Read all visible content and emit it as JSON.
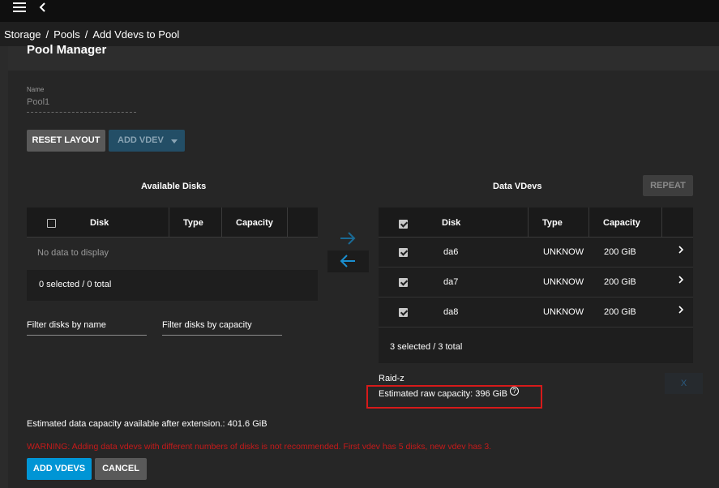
{
  "topbar": {
    "menu_icon": "hamburger-menu-icon",
    "back_icon": "chevron-left-icon"
  },
  "breadcrumb": {
    "items": [
      "Storage",
      "Pools",
      "Add Vdevs to Pool"
    ],
    "separator": "/"
  },
  "page": {
    "title": "Pool Manager",
    "name_label": "Name",
    "name_value": "Pool1",
    "reset_layout": "RESET LAYOUT",
    "add_vdev": "ADD VDEV"
  },
  "available_disks": {
    "title": "Available Disks",
    "columns": [
      "Disk",
      "Type",
      "Capacity"
    ],
    "empty_text": "No data to display",
    "footer": "0 selected / 0 total",
    "filter_name": "Filter disks by name",
    "filter_capacity": "Filter disks by capacity"
  },
  "data_vdevs": {
    "title": "Data VDevs",
    "repeat": "REPEAT",
    "columns": [
      "Disk",
      "Type",
      "Capacity"
    ],
    "rows": [
      {
        "disk": "da6",
        "type": "UNKNOW",
        "capacity": "200 GiB",
        "checked": true
      },
      {
        "disk": "da7",
        "type": "UNKNOW",
        "capacity": "200 GiB",
        "checked": true
      },
      {
        "disk": "da8",
        "type": "UNKNOW",
        "capacity": "200 GiB",
        "checked": true
      }
    ],
    "footer": "3 selected / 3 total",
    "raid_type": "Raid-z",
    "estimated_raw": "Estimated raw capacity: 396 GiB",
    "remove_label": "X"
  },
  "summary": {
    "estimated_data": "Estimated data capacity available after extension.: 401.6 GiB",
    "warning": "WARNING: Adding data vdevs with different numbers of disks is not recommended. First vdev has 5 disks, new vdev has 3."
  },
  "actions": {
    "add_vdevs": "ADD VDEVS",
    "cancel": "CANCEL"
  },
  "colors": {
    "accent": "#0095d5",
    "warning": "#c51a1a",
    "highlight": "#d61a1a"
  }
}
